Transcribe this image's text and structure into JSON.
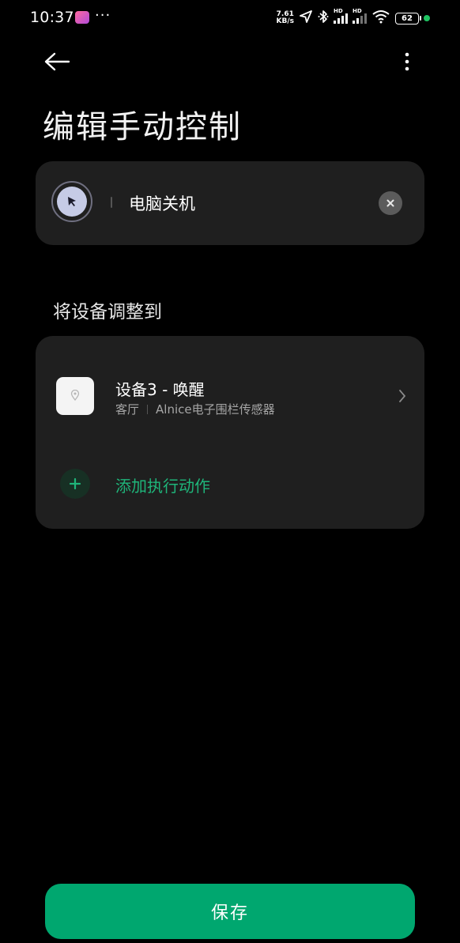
{
  "status_bar": {
    "time": "10:37",
    "dots": "···",
    "net_speed_value": "7.61",
    "net_speed_unit": "KB/s",
    "sim1_label": "HD",
    "sim2_label": "HD",
    "battery": "62",
    "icons": [
      "app-icon",
      "location-icon",
      "bluetooth-icon",
      "signal-icon",
      "wifi-icon",
      "battery-icon"
    ]
  },
  "header": {
    "title": "编辑手动控制",
    "back_icon": "back-arrow-icon",
    "more_icon": "more-vertical-icon"
  },
  "control": {
    "name": "电脑关机",
    "icon": "cursor-icon",
    "clear_icon": "clear-icon"
  },
  "section": {
    "label": "将设备调整到"
  },
  "action": {
    "device_title": "设备3 - 唤醒",
    "device_room": "客厅",
    "device_type": "Alnice电子围栏传感器",
    "add_label": "添加执行动作"
  },
  "footer": {
    "save_label": "保存"
  },
  "colors": {
    "background": "#000000",
    "card": "#1f1f1f",
    "accent": "#00a76f",
    "add_text": "#1fb57a"
  }
}
